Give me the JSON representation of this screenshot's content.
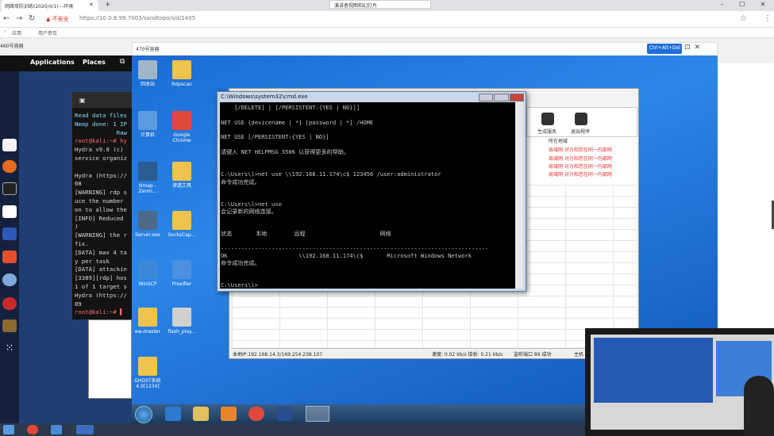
{
  "browser": {
    "tab_title": "网络攻防训练(2020/4/1)---环境",
    "popup_text": "演讲者视图和幻灯片",
    "insecure_label": "不安全",
    "url": "https://10.0.8.99:7003/sandtopo/sid/1405",
    "bookmarks": [
      "应用",
      "用户意见"
    ]
  },
  "page": {
    "header": "460号容器"
  },
  "vm": {
    "title": "470号容器",
    "button": "Ctrl+Alt+Del"
  },
  "kali": {
    "topbar": [
      "Applications",
      "Places"
    ],
    "terminal_lines": [
      {
        "t": "Read data files",
        "c": "#8fd8ff"
      },
      {
        "t": "Nmap done: 1 IP",
        "c": "#8fd8ff"
      },
      {
        "t": "            Raw",
        "c": "#8fd8ff"
      },
      {
        "t": "root@kali:~# hy",
        "c": "#ff6b6b"
      },
      {
        "t": "Hydra v9.0 (c)",
        "c": "#d8d8d8"
      },
      {
        "t": "service organiz",
        "c": "#d8d8d8"
      },
      {
        "t": "",
        "c": "#d8d8d8"
      },
      {
        "t": "Hydra (https://",
        "c": "#d8d8d8"
      },
      {
        "t": "08",
        "c": "#d8d8d8"
      },
      {
        "t": "[WARNING] rdp s",
        "c": "#d8d8d8"
      },
      {
        "t": "uce the number",
        "c": "#d8d8d8"
      },
      {
        "t": "on to allow the",
        "c": "#d8d8d8"
      },
      {
        "t": "[INFO] Reduced",
        "c": "#d8d8d8"
      },
      {
        "t": ")",
        "c": "#d8d8d8"
      },
      {
        "t": "[WARNING] the r",
        "c": "#d8d8d8"
      },
      {
        "t": "fix.",
        "c": "#d8d8d8"
      },
      {
        "t": "[DATA] max 4 ta",
        "c": "#d8d8d8"
      },
      {
        "t": "y per task",
        "c": "#d8d8d8"
      },
      {
        "t": "[DATA] attackin",
        "c": "#d8d8d8"
      },
      {
        "t": "[3389][rdp] hos",
        "c": "#d8d8d8"
      },
      {
        "t": "1 of 1 target s",
        "c": "#d8d8d8"
      },
      {
        "t": "Hydra (https://",
        "c": "#d8d8d8"
      },
      {
        "t": "09",
        "c": "#d8d8d8"
      },
      {
        "t": "root@kali:~# ▌",
        "c": "#ff6b6b"
      }
    ]
  },
  "desktop": {
    "icons": [
      {
        "label": "回收站",
        "color": "#9fb6c8"
      },
      {
        "label": "Rdpscan",
        "color": "#f0c34a"
      },
      {
        "label": "计算机",
        "color": "#5a9be0"
      },
      {
        "label": "Google Chrome",
        "color": "#e2473b"
      },
      {
        "label": "Nmap - Zenm...",
        "color": "#2a5d92"
      },
      {
        "label": "渗透工具",
        "color": "#f0c34a"
      },
      {
        "label": "Server.exe",
        "color": "#4d6a89"
      },
      {
        "label": "SocksCap...",
        "color": "#f0c34a"
      },
      {
        "label": "WinSCP",
        "color": "#3b88d8"
      },
      {
        "label": "Proxifier",
        "color": "#4d8fe0"
      },
      {
        "label": "ew-master",
        "color": "#f0c34a"
      },
      {
        "label": "flash_play...",
        "color": "#d0d0d0"
      },
      {
        "label": "GHOST系统 4.0[1234]",
        "color": "#f0c34a"
      }
    ]
  },
  "backapp": {
    "toolbar": [
      "生成服务",
      "退出程序"
    ],
    "col_header": "所在地域",
    "rows": [
      "局域网 对方和您在同一内部网",
      "局域网 对方和您在同一内部网",
      "局域网 对方和您在同一内部网",
      "局域网 对方和您在同一内部网"
    ],
    "status": [
      "本地IP:192.168.14.3/169.254.238.107",
      "速度: 0.02 kb/s 接收: 0.21 kb/s",
      "监听端口 89 成功",
      "主机"
    ]
  },
  "cmd": {
    "title": "C:\\Windows\\system32\\cmd.exe",
    "lines": [
      "    [/DELETE] | [/PERSISTENT:{YES | NO}]]",
      "",
      "NET USE {devicename | *} [password | *] /HOME",
      "",
      "NET USE [/PERSISTENT:{YES | NO}]",
      "",
      "请键入 NET HELPMSG 3506 以获得更多的帮助。",
      "",
      "",
      "C:\\Users\\l>net use \\\\192.168.11.174\\c$ 123456 /user:administrator",
      "命令成功完成。",
      "",
      "",
      "C:\\Users\\l>net use",
      "会记录新的网络连接。",
      "",
      "",
      "状态       本地        远程                      网络",
      "",
      "-------------------------------------------------------------------------------",
      "OK                     \\\\192.168.11.174\\c$       Microsoft Windows Network",
      "命令成功完成。",
      "",
      "",
      "C:\\Users\\l>"
    ]
  }
}
